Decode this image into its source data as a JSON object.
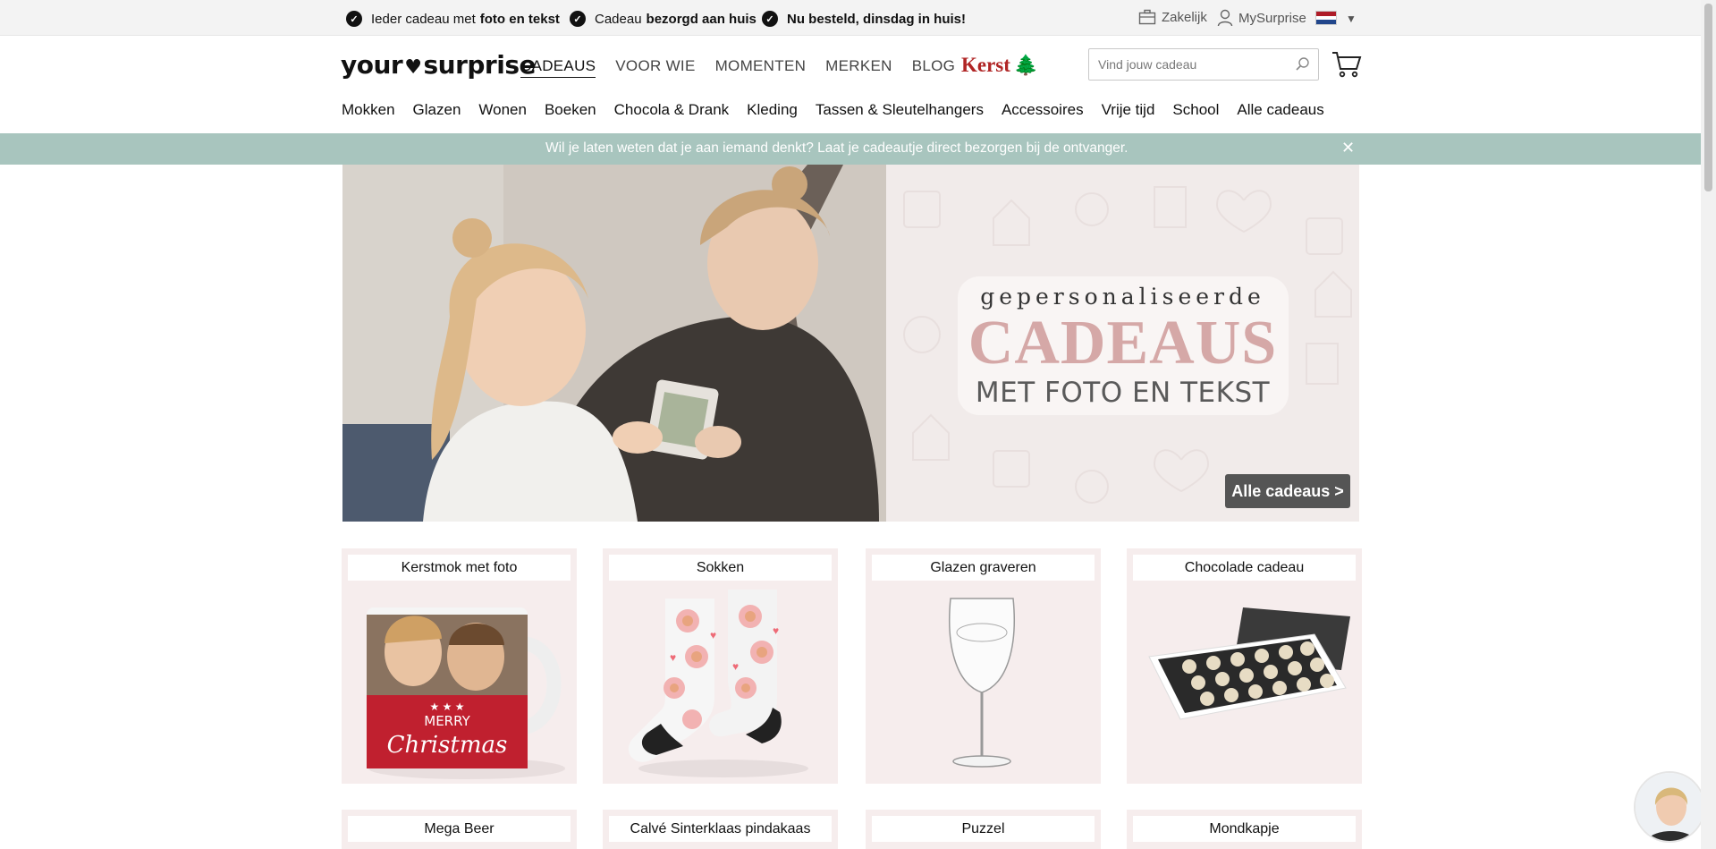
{
  "topbar": {
    "usps": [
      {
        "normal": "Ieder cadeau met",
        "bold": "foto en tekst"
      },
      {
        "normal": "Cadeau",
        "bold": "bezorgd aan huis"
      },
      {
        "normal": "",
        "bold": "Nu besteld, dinsdag in huis!"
      }
    ],
    "zakelijk": "Zakelijk",
    "mysurprise": "MySurprise",
    "country_flag": "nl-flag-icon"
  },
  "header": {
    "logo_left": "your",
    "logo_right": "surprise",
    "main_nav": [
      "CADEAUS",
      "VOOR WIE",
      "MOMENTEN",
      "MERKEN",
      "BLOG"
    ],
    "kerst_label": "Kerst",
    "search_placeholder": "Vind jouw cadeau"
  },
  "subnav": [
    "Mokken",
    "Glazen",
    "Wonen",
    "Boeken",
    "Chocola & Drank",
    "Kleding",
    "Tassen & Sleutelhangers",
    "Accessoires",
    "Vrije tijd",
    "School",
    "Alle cadeaus"
  ],
  "announcement": "Wil je laten weten dat je aan iemand denkt? Laat je cadeautje direct bezorgen bij de ontvanger.",
  "hero": {
    "small": "gepersonaliseerde",
    "big": "CADEAUS",
    "mid": "MET FOTO EN TEKST",
    "button": "Alle cadeaus >"
  },
  "products_row1": [
    "Kerstmok met foto",
    "Sokken",
    "Glazen graveren",
    "Chocolade cadeau"
  ],
  "products_row2": [
    "Mega Beer",
    "Calvé Sinterklaas pindakaas",
    "Puzzel",
    "Mondkapje"
  ],
  "mug_text": {
    "line1": "MERRY",
    "line2": "Christmas"
  },
  "colors": {
    "announce_bg": "#a8c5be",
    "card_bg": "#f6eded",
    "hero_pink": "#d5a8a7",
    "kerst_red": "#b02525"
  }
}
